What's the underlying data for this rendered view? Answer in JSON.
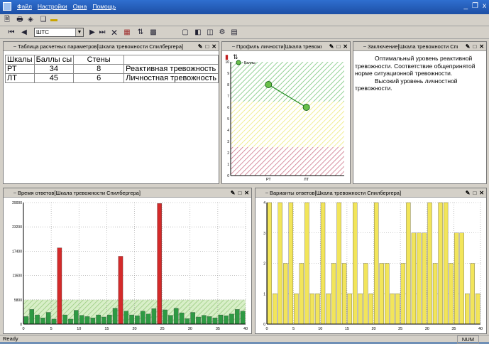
{
  "window": {
    "menu": [
      "Файл",
      "Настройки",
      "Окна",
      "Помощь"
    ],
    "controls": [
      "_",
      "ð",
      "x"
    ]
  },
  "toolbar2": {
    "test_value": "ШТС"
  },
  "table_panel": {
    "title": "Таблица расчетных параметров[Шкала тревожности Спилбергера]",
    "headers": [
      "Шкалы",
      "Баллы сы",
      "Стены",
      ""
    ],
    "rows": [
      {
        "scale": "РТ",
        "score": "34",
        "sten": "8",
        "name": "Реактивная тревожность"
      },
      {
        "scale": "ЛТ",
        "score": "45",
        "sten": "6",
        "name": "Личностная тревожность"
      }
    ]
  },
  "profile_panel": {
    "title": "Профиль личности[Шкала тревожно",
    "legend": "- Баллы",
    "chart_data": {
      "type": "line",
      "categories": [
        "РТ",
        "ЛТ"
      ],
      "series": [
        {
          "name": "Баллы",
          "values": [
            8,
            6
          ]
        }
      ],
      "ylim": [
        0,
        10
      ],
      "yticks": [
        "0",
        "1",
        "2",
        "3",
        "4",
        "5",
        "6",
        "7",
        "8",
        "9",
        "10"
      ],
      "zones": [
        {
          "from": 6.5,
          "to": 10,
          "color": "#58b85a"
        },
        {
          "from": 2.5,
          "to": 6.5,
          "color": "#e8e45a"
        },
        {
          "from": 0,
          "to": 2.5,
          "color": "#c0506a"
        }
      ]
    }
  },
  "conclusion_panel": {
    "title": "Заключение[Шкала тревожности Спил",
    "paragraphs": [
      "Оптимальный уровень реактивной тревожности. Соответствие общепринятой норме ситуационной тревожности.",
      "Высокий уровень личностной тревожности."
    ]
  },
  "time_panel": {
    "title": "Время ответов[Шкала тревожности Спилбергера]",
    "chart_data": {
      "type": "bar",
      "x": [
        1,
        2,
        3,
        4,
        5,
        6,
        7,
        8,
        9,
        10,
        11,
        12,
        13,
        14,
        15,
        16,
        17,
        18,
        19,
        20,
        21,
        22,
        23,
        24,
        25,
        26,
        27,
        28,
        29,
        30,
        31,
        32,
        33,
        34,
        35,
        36,
        37,
        38,
        39,
        40
      ],
      "values": [
        1800,
        3500,
        2200,
        1500,
        2800,
        1200,
        18200,
        2200,
        1200,
        3300,
        2100,
        1800,
        1500,
        2200,
        1700,
        2200,
        3800,
        16200,
        3100,
        2200,
        2000,
        3100,
        2400,
        3700,
        28800,
        3400,
        2100,
        3800,
        2700,
        1300,
        2800,
        1700,
        2100,
        1800,
        1500,
        2200,
        2000,
        2400,
        3500,
        3100
      ],
      "highlight": [
        7,
        18,
        25
      ],
      "band": [
        0,
        5800
      ],
      "ylim": [
        0,
        29000
      ],
      "yticks": [
        "0",
        "5800",
        "11600",
        "17400",
        "23200",
        "29000"
      ],
      "xticks": [
        "0",
        "5",
        "10",
        "15",
        "20",
        "25",
        "30",
        "35",
        "40"
      ],
      "colors": {
        "bar": "#2e9a43",
        "highlight": "#d42a2a",
        "band": "#b6dba0"
      }
    }
  },
  "variants_panel": {
    "title": "Варианты ответов[Шкала тревожности Спилбергера]",
    "chart_data": {
      "type": "bar",
      "x": [
        1,
        2,
        3,
        4,
        5,
        6,
        7,
        8,
        9,
        10,
        11,
        12,
        13,
        14,
        15,
        16,
        17,
        18,
        19,
        20,
        21,
        22,
        23,
        24,
        25,
        26,
        27,
        28,
        29,
        30,
        31,
        32,
        33,
        34,
        35,
        36,
        37,
        38,
        39,
        40
      ],
      "values": [
        4,
        1,
        4,
        2,
        4,
        1,
        2,
        4,
        1,
        1,
        4,
        1,
        2,
        4,
        2,
        1,
        4,
        1,
        2,
        1,
        4,
        2,
        2,
        1,
        1,
        2,
        4,
        3,
        3,
        3,
        4,
        2,
        4,
        4,
        2,
        3,
        3,
        1,
        2,
        1
      ],
      "ylim": [
        0,
        4
      ],
      "yticks": [
        "0",
        "1",
        "2",
        "3",
        "4"
      ],
      "xticks": [
        "0",
        "5",
        "10",
        "15",
        "20",
        "25",
        "30",
        "35",
        "40"
      ],
      "colors": {
        "bar": "#f2e55a"
      }
    }
  },
  "statusbar": {
    "left": "Ready",
    "right": "NUM"
  }
}
